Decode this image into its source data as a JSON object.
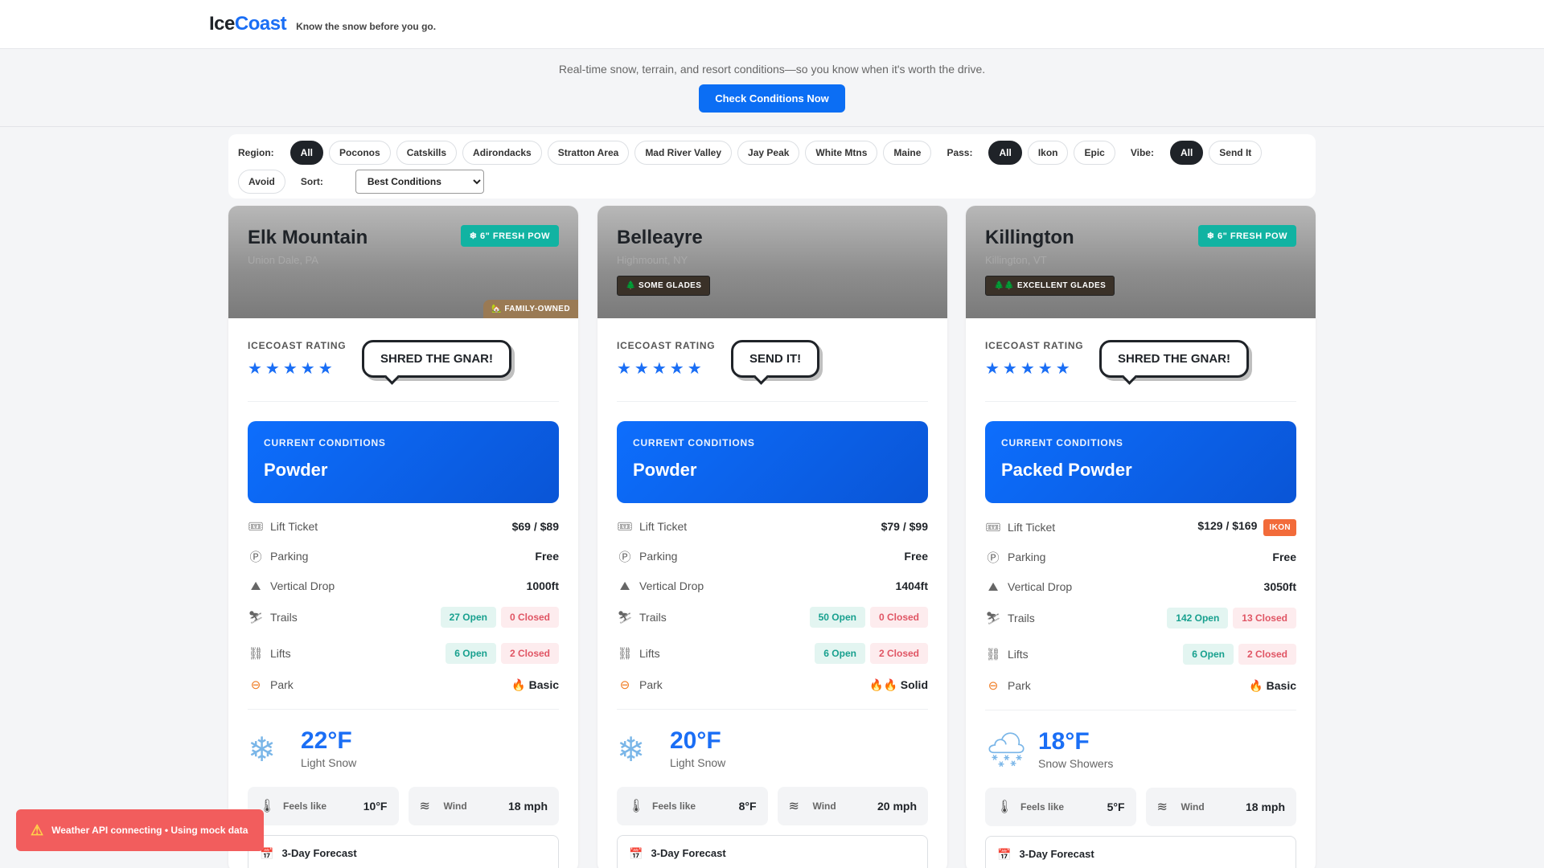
{
  "header": {
    "logo_ice": "Ice",
    "logo_coast": "Coast",
    "tagline": "Know the snow before you go."
  },
  "hero": {
    "subtitle": "Real-time snow, terrain, and resort conditions—so you know when it's worth the drive.",
    "cta_label": "Check Conditions Now"
  },
  "filters": {
    "region_label": "Region:",
    "regions": [
      "All",
      "Poconos",
      "Catskills",
      "Adirondacks",
      "Stratton Area",
      "Mad River Valley",
      "Jay Peak",
      "White Mtns",
      "Maine"
    ],
    "pass_label": "Pass:",
    "passes": [
      "All",
      "Ikon",
      "Epic"
    ],
    "vibe_label": "Vibe:",
    "vibes": [
      "All",
      "Send It",
      "Avoid"
    ],
    "sort_label": "Sort:",
    "sort_value": "Best Conditions"
  },
  "labels": {
    "rating": "ICECOAST RATING",
    "current_conditions": "CURRENT CONDITIONS",
    "lift_ticket": "Lift Ticket",
    "parking": "Parking",
    "vertical_drop": "Vertical Drop",
    "trails": "Trails",
    "lifts": "Lifts",
    "park": "Park",
    "feels_like": "Feels like",
    "wind": "Wind",
    "forecast": "3-Day Forecast"
  },
  "cards": [
    {
      "name": "Elk Mountain",
      "location": "Union Dale, PA",
      "pow_badge": "❄ 6\" FRESH POW",
      "corner_badge": "🏡 FAMILY-OWNED",
      "stars": "★★★★★",
      "bubble": "SHRED THE GNAR!",
      "conditions": "Powder",
      "lift_ticket": "$69 / $89",
      "parking": "Free",
      "vertical": "1000ft",
      "trails_open": "27 Open",
      "trails_closed": "0 Closed",
      "lifts_open": "6 Open",
      "lifts_closed": "2 Closed",
      "park": "🔥 Basic",
      "weather_icon": "❄",
      "temp": "22°F",
      "weather_desc": "Light Snow",
      "feels_like": "10°F",
      "wind": "18 mph"
    },
    {
      "name": "Belleayre",
      "location": "Highmount, NY",
      "glade_badge": "🌲 SOME GLADES",
      "stars": "★★★★★",
      "bubble": "SEND IT!",
      "conditions": "Powder",
      "lift_ticket": "$79 / $99",
      "parking": "Free",
      "vertical": "1404ft",
      "trails_open": "50 Open",
      "trails_closed": "0 Closed",
      "lifts_open": "6 Open",
      "lifts_closed": "2 Closed",
      "park": "🔥🔥 Solid",
      "weather_icon": "❄",
      "temp": "20°F",
      "weather_desc": "Light Snow",
      "feels_like": "8°F",
      "wind": "20 mph"
    },
    {
      "name": "Killington",
      "location": "Killington, VT",
      "pow_badge": "❄ 6\" FRESH POW",
      "glade_badge": "🌲🌲 EXCELLENT GLADES",
      "stars": "★★★★★",
      "bubble": "SHRED THE GNAR!",
      "conditions": "Packed Powder",
      "lift_ticket": "$129 / $169",
      "ikon_tag": "IKON",
      "parking": "Free",
      "vertical": "3050ft",
      "trails_open": "142 Open",
      "trails_closed": "13 Closed",
      "lifts_open": "6 Open",
      "lifts_closed": "2 Closed",
      "park": "🔥 Basic",
      "weather_icon": "🌨",
      "temp": "18°F",
      "weather_desc": "Snow Showers",
      "feels_like": "5°F",
      "wind": "18 mph"
    }
  ],
  "toast": {
    "icon": "⚠",
    "message": "Weather API connecting • Using mock data"
  },
  "colors": {
    "accent": "#1a6ef5",
    "fresh_pow": "#11b3a2",
    "toast": "#f25d5d",
    "ikon": "#f26b3a"
  }
}
